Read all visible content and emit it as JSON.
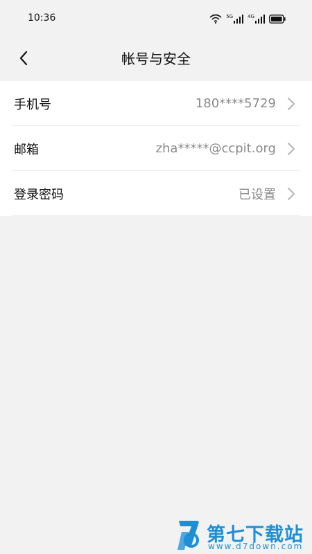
{
  "status_bar": {
    "time": "10:36",
    "network_labels": [
      "5G",
      "4G"
    ]
  },
  "header": {
    "title": "帐号与安全"
  },
  "account_items": [
    {
      "label": "手机号",
      "value": "180****5729"
    },
    {
      "label": "邮箱",
      "value": "zha*****@ccpit.org"
    },
    {
      "label": "登录密码",
      "value": "已设置"
    }
  ],
  "watermark": {
    "text": "第七下载站",
    "url": "www.d7down.com",
    "color": "#1c8fd6"
  },
  "colors": {
    "background": "#f2f2f2",
    "card": "#ffffff",
    "label": "#111111",
    "value": "#8a8a8a",
    "chevron": "#b5b5b5"
  },
  "icons": {
    "back": "chevron-left-icon",
    "row_arrow": "chevron-right-icon",
    "wifi": "wifi-icon",
    "signal": "signal-icon",
    "battery": "battery-icon"
  }
}
